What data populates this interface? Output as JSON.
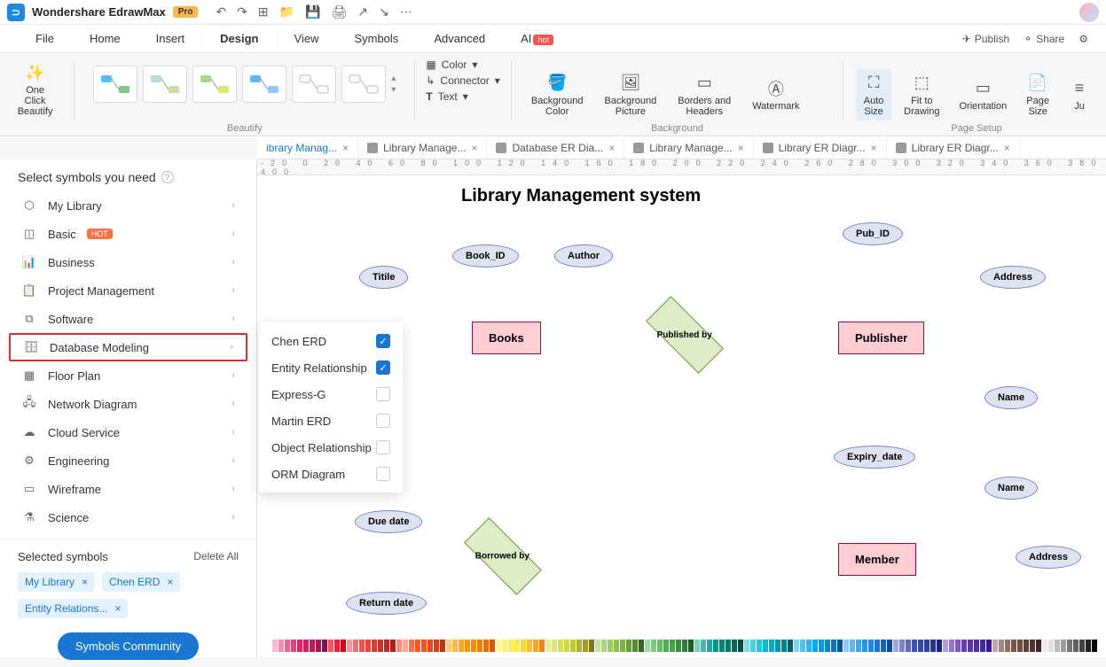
{
  "titlebar": {
    "app_name": "Wondershare EdrawMax",
    "badge": "Pro"
  },
  "menubar": {
    "items": [
      "File",
      "Home",
      "Insert",
      "Design",
      "View",
      "Symbols",
      "Advanced",
      "AI"
    ],
    "active_index": 3,
    "ai_badge": "hot",
    "right": {
      "publish": "Publish",
      "share": "Share"
    }
  },
  "ribbon": {
    "beautify": {
      "one_click": "One Click\nBeautify",
      "group_label": "Beautify"
    },
    "text_col": {
      "color": "Color",
      "connector": "Connector",
      "text": "Text"
    },
    "background": {
      "bg_color": "Background\nColor",
      "bg_picture": "Background\nPicture",
      "borders": "Borders and\nHeaders",
      "watermark": "Watermark",
      "group_label": "Background"
    },
    "page_setup": {
      "auto_size": "Auto\nSize",
      "fit_drawing": "Fit to\nDrawing",
      "orientation": "Orientation",
      "page_size": "Page\nSize",
      "just": "Ju",
      "group_label": "Page Setup"
    }
  },
  "doc_tabs": [
    {
      "label": "ibrary Manag...",
      "active": true
    },
    {
      "label": "Library Manage..."
    },
    {
      "label": "Database ER Dia..."
    },
    {
      "label": "Library Manage..."
    },
    {
      "label": "Library ER Diagr..."
    },
    {
      "label": "Library ER Diagr..."
    }
  ],
  "sidebar": {
    "title": "Select symbols you need",
    "categories": [
      {
        "label": "My Library"
      },
      {
        "label": "Basic",
        "hot": true
      },
      {
        "label": "Business"
      },
      {
        "label": "Project Management"
      },
      {
        "label": "Software"
      },
      {
        "label": "Database Modeling",
        "highlighted": true
      },
      {
        "label": "Floor Plan"
      },
      {
        "label": "Network Diagram"
      },
      {
        "label": "Cloud Service"
      },
      {
        "label": "Engineering"
      },
      {
        "label": "Wireframe"
      },
      {
        "label": "Science"
      }
    ],
    "selected_title": "Selected symbols",
    "delete_all": "Delete All",
    "chips": [
      "My Library",
      "Chen ERD",
      "Entity Relations..."
    ],
    "community_btn": "Symbols Community"
  },
  "flyout": [
    {
      "label": "Chen ERD",
      "checked": true
    },
    {
      "label": "Entity Relationship",
      "checked": true
    },
    {
      "label": "Express-G",
      "checked": false
    },
    {
      "label": "Martin ERD",
      "checked": false
    },
    {
      "label": "Object Relationship",
      "checked": false
    },
    {
      "label": "ORM Diagram",
      "checked": false
    }
  ],
  "canvas": {
    "title": "Library Management system",
    "entities": {
      "books": "Books",
      "publisher": "Publisher",
      "member": "Member"
    },
    "attrs": {
      "title": "Titile",
      "book_id": "Book_ID",
      "author": "Author",
      "pub_id": "Pub_ID",
      "address1": "Address",
      "name1": "Name",
      "due_date": "Due date",
      "return_date": "Return date",
      "expiry_date": "Expiry_date",
      "name2": "Name",
      "address2": "Address"
    },
    "rels": {
      "published_by": "Published by",
      "borrowed_by": "Borrowed by"
    }
  },
  "ruler_marks": "-20   0   20   40   60   80   100   120   140   160   180   200   220   240   260   280   300   320   340   360   380   400",
  "colorbar": [
    "#fff",
    "#f8bbd0",
    "#f48fb1",
    "#f06292",
    "#ec407a",
    "#e91e63",
    "#d81b60",
    "#c2185b",
    "#ad1457",
    "#880e4f",
    "#ff5252",
    "#ff1744",
    "#d50000",
    "#ef9a9a",
    "#e57373",
    "#ef5350",
    "#f44336",
    "#e53935",
    "#d32f2f",
    "#c62828",
    "#b71c1c",
    "#ff8a80",
    "#ffab91",
    "#ff7043",
    "#ff5722",
    "#f4511e",
    "#e64a19",
    "#d84315",
    "#bf360c",
    "#ffcc80",
    "#ffb74d",
    "#ffa726",
    "#ff9800",
    "#fb8c00",
    "#f57c00",
    "#ef6c00",
    "#e65100",
    "#fff59d",
    "#fff176",
    "#ffee58",
    "#ffeb3b",
    "#fdd835",
    "#fbc02d",
    "#f9a825",
    "#f57f17",
    "#e6ee9c",
    "#dce775",
    "#d4e157",
    "#cddc39",
    "#c0ca33",
    "#afb42b",
    "#9e9d24",
    "#827717",
    "#c5e1a5",
    "#aed581",
    "#9ccc65",
    "#8bc34a",
    "#7cb342",
    "#689f38",
    "#558b2f",
    "#33691e",
    "#a5d6a7",
    "#81c784",
    "#66bb6a",
    "#4caf50",
    "#43a047",
    "#388e3c",
    "#2e7d32",
    "#1b5e20",
    "#80cbc4",
    "#4db6ac",
    "#26a69a",
    "#009688",
    "#00897b",
    "#00796b",
    "#00695c",
    "#004d40",
    "#80deea",
    "#4dd0e1",
    "#26c6da",
    "#00bcd4",
    "#00acc1",
    "#0097a7",
    "#00838f",
    "#006064",
    "#81d4fa",
    "#4fc3f7",
    "#29b6f6",
    "#03a9f4",
    "#039be5",
    "#0288d1",
    "#0277bd",
    "#01579b",
    "#90caf9",
    "#64b5f6",
    "#42a5f5",
    "#2196f3",
    "#1e88e5",
    "#1976d2",
    "#1565c0",
    "#0d47a1",
    "#9fa8da",
    "#7986cb",
    "#5c6bc0",
    "#3f51b5",
    "#3949ab",
    "#303f9f",
    "#283593",
    "#1a237e",
    "#b39ddb",
    "#9575cd",
    "#7e57c2",
    "#673ab7",
    "#5e35b1",
    "#512da8",
    "#4527a0",
    "#311b92",
    "#bcaaa4",
    "#a1887f",
    "#8d6e63",
    "#795548",
    "#6d4c41",
    "#5d4037",
    "#4e342e",
    "#3e2723",
    "#eee",
    "#e0e0e0",
    "#bdbdbd",
    "#9e9e9e",
    "#757575",
    "#616161",
    "#424242",
    "#212121",
    "#000"
  ]
}
